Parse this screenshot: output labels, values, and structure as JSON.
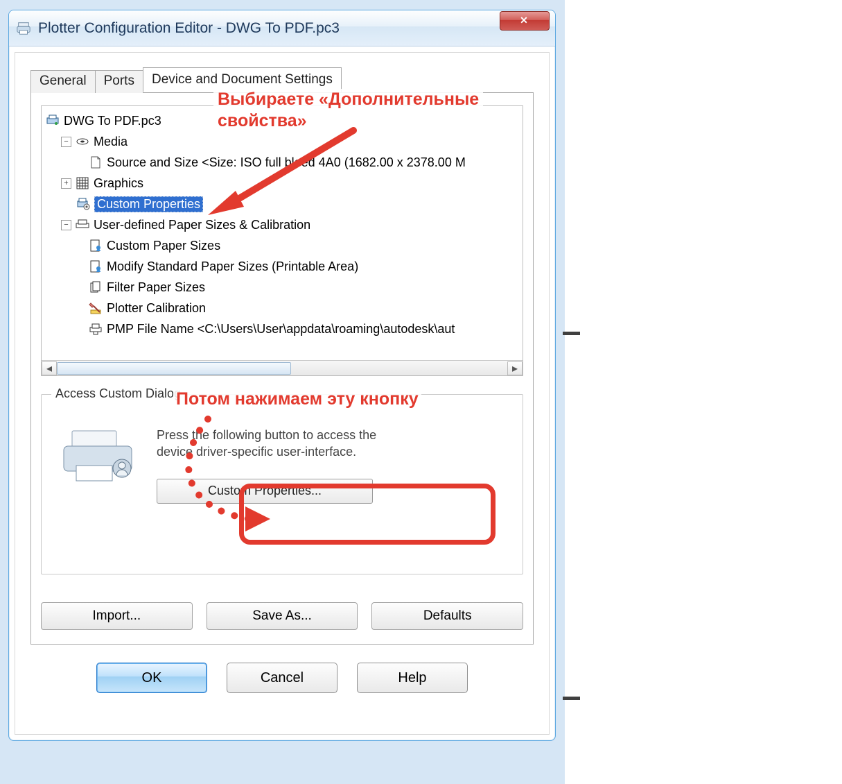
{
  "annotations": {
    "line1": "Выбираете «Дополнительные",
    "line2": "свойства»",
    "box2": "Потом нажимаем эту кнопку"
  },
  "titlebar": {
    "title": "Plotter Configuration Editor - DWG To PDF.pc3",
    "close": "X"
  },
  "tabs": {
    "general": "General",
    "ports": "Ports",
    "device": "Device and Document Settings"
  },
  "tree": {
    "root": "DWG To PDF.pc3",
    "media": "Media",
    "source": "Source and Size <Size: ISO full bleed 4A0 (1682.00 x 2378.00 M",
    "graphics": "Graphics",
    "custom_properties": "Custom Properties",
    "udps": "User-defined Paper Sizes & Calibration",
    "cps": "Custom Paper Sizes",
    "modify": "Modify Standard Paper Sizes (Printable Area)",
    "filter": "Filter Paper Sizes",
    "calib": "Plotter Calibration",
    "pmp": "PMP File Name <C:\\Users\\User\\appdata\\roaming\\autodesk\\aut"
  },
  "group": {
    "legend": "Access Custom Dialog",
    "text_a": "Press the following button to access the",
    "text_b": "device driver-specific user-interface.",
    "button": "Custom Properties..."
  },
  "buttons": {
    "import": "Import...",
    "saveas": "Save As...",
    "defaults": "Defaults",
    "ok": "OK",
    "cancel": "Cancel",
    "help": "Help"
  }
}
